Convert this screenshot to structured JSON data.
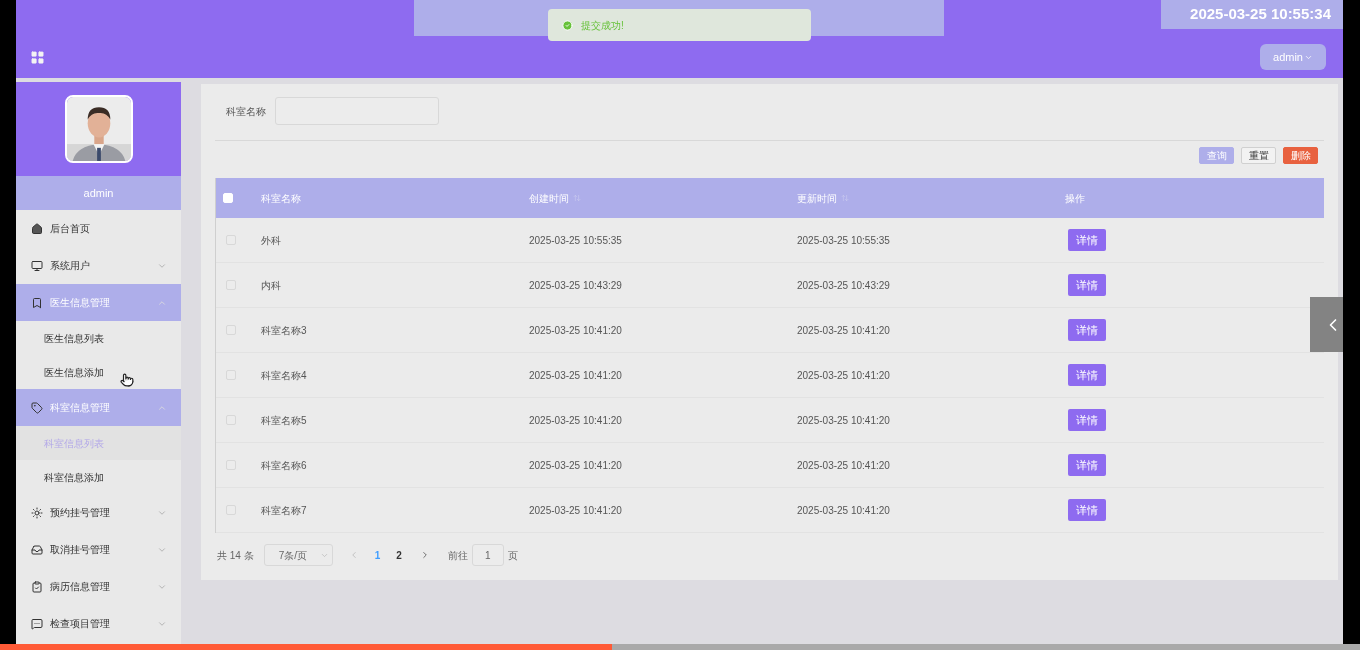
{
  "header": {
    "datetime": "2025-03-25 10:55:34",
    "user_menu": "admin"
  },
  "toast": {
    "kind": "success",
    "message": "提交成功!"
  },
  "sidebar": {
    "username": "admin",
    "menu": [
      {
        "kind": "link",
        "label": "后台首页"
      },
      {
        "kind": "submenu",
        "label": "系统用户",
        "expanded": false
      },
      {
        "kind": "submenu",
        "label": "医生信息管理",
        "expanded": true,
        "children": [
          {
            "label": "医生信息列表",
            "selected": false
          },
          {
            "label": "医生信息添加",
            "selected": false
          }
        ]
      },
      {
        "kind": "submenu",
        "label": "科室信息管理",
        "expanded": true,
        "children": [
          {
            "label": "科室信息列表",
            "selected": true
          },
          {
            "label": "科室信息添加",
            "selected": false
          }
        ]
      },
      {
        "kind": "submenu",
        "label": "预约挂号管理",
        "expanded": false
      },
      {
        "kind": "submenu",
        "label": "取消挂号管理",
        "expanded": false
      },
      {
        "kind": "submenu",
        "label": "病历信息管理",
        "expanded": false
      },
      {
        "kind": "submenu",
        "label": "检查项目管理",
        "expanded": false
      }
    ]
  },
  "search": {
    "label": "科室名称"
  },
  "actions": [
    {
      "kind": "primary",
      "label": "查询"
    },
    {
      "kind": "plain",
      "label": "重置"
    },
    {
      "kind": "danger",
      "label": "删除"
    }
  ],
  "table": {
    "select_all": {
      "checked": false
    },
    "columns": [
      {
        "label": "科室名称",
        "sortable": false
      },
      {
        "label": "创建时间",
        "sortable": true
      },
      {
        "label": "更新时间",
        "sortable": true
      },
      {
        "label": "操作",
        "sortable": false
      }
    ],
    "rows": [
      {
        "checked": false,
        "name": "外科",
        "created": "2025-03-25 10:55:35",
        "updated": "2025-03-25 10:55:35",
        "action": "详情"
      },
      {
        "checked": false,
        "name": "内科",
        "created": "2025-03-25 10:43:29",
        "updated": "2025-03-25 10:43:29",
        "action": "详情"
      },
      {
        "checked": false,
        "name": "科室名称3",
        "created": "2025-03-25 10:41:20",
        "updated": "2025-03-25 10:41:20",
        "action": "详情"
      },
      {
        "checked": false,
        "name": "科室名称4",
        "created": "2025-03-25 10:41:20",
        "updated": "2025-03-25 10:41:20",
        "action": "详情"
      },
      {
        "checked": false,
        "name": "科室名称5",
        "created": "2025-03-25 10:41:20",
        "updated": "2025-03-25 10:41:20",
        "action": "详情"
      },
      {
        "checked": false,
        "name": "科室名称6",
        "created": "2025-03-25 10:41:20",
        "updated": "2025-03-25 10:41:20",
        "action": "详情"
      },
      {
        "checked": false,
        "name": "科室名称7",
        "created": "2025-03-25 10:41:20",
        "updated": "2025-03-25 10:41:20",
        "action": "详情"
      }
    ]
  },
  "pagination": {
    "total": "共 14 条",
    "page_size": "7条/页",
    "pages": [
      {
        "label": "1",
        "selected": true
      },
      {
        "label": "2",
        "selected": false
      }
    ],
    "goto_label": "前往",
    "goto_value": "1",
    "goto_suffix": "页"
  },
  "video_progress": {
    "level": 0.45
  }
}
